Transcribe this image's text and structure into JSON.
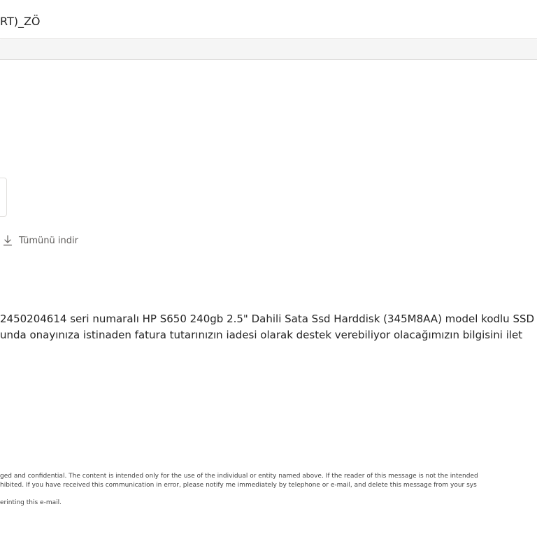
{
  "email": {
    "subject": "RT)_ZÖ",
    "attachments": {
      "download_all_label": "Tümünü indir"
    },
    "body": {
      "line1": "2450204614 seri numaralı HP S650 240gb 2.5\" Dahili Sata Ssd Harddisk (345M8AA) model kodlu SSD",
      "line2": "unda onayınıza istinaden fatura tutarınızın iadesi olarak destek verebiliyor olacağımızın bilgisini ilet"
    },
    "disclaimer": {
      "line1": "ged and confidential. The content is intended only for the use of the individual or entity named above. If the reader of this message is not the intended",
      "line2": "hibited. If you have received this communication in error, please notify me immediately by telephone or e-mail, and delete this message from your sys",
      "line3": "erinting this e-mail."
    }
  }
}
